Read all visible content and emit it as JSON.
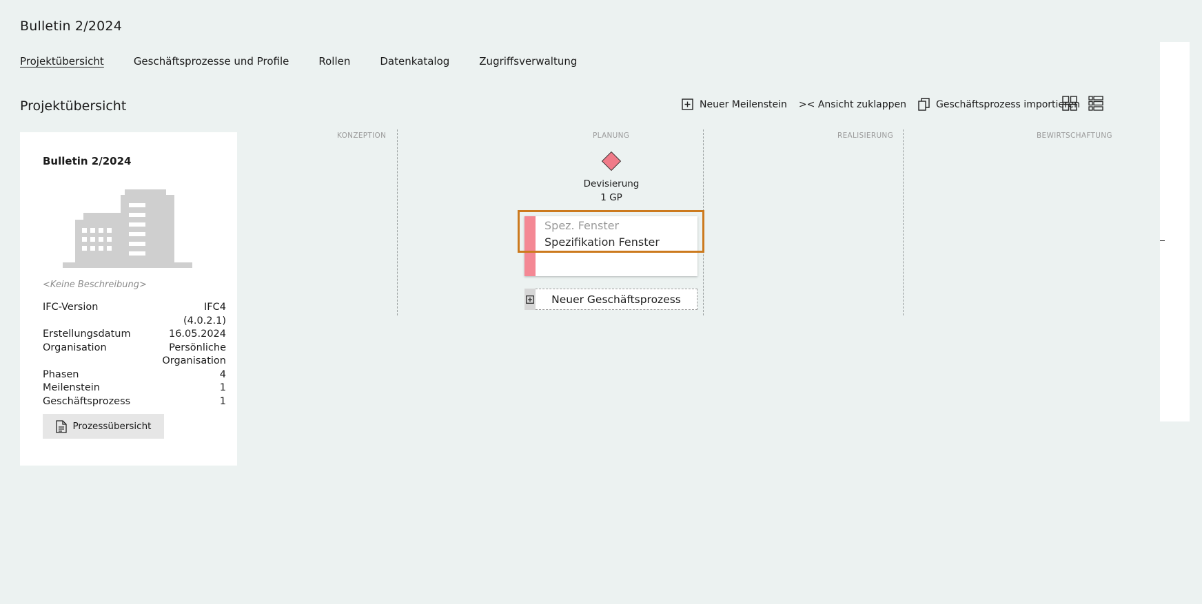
{
  "app": {
    "title": "Bulletin 2/2024"
  },
  "tabs": [
    {
      "label": "Projektübersicht",
      "active": true
    },
    {
      "label": "Geschäftsprozesse und Profile"
    },
    {
      "label": "Rollen"
    },
    {
      "label": "Datenkatalog"
    },
    {
      "label": "Zugriffsverwaltung"
    }
  ],
  "page": {
    "title": "Projektübersicht"
  },
  "toolbar": {
    "new_milestone": "Neuer Meilenstein",
    "collapse_view": "&gt;&lt; Ansicht zuklappen",
    "import_process": "Geschäftsprozess importieren",
    "grid_view_icon": "grid-view-icon",
    "list_view_icon": "list-view-icon"
  },
  "project_card": {
    "title": "Bulletin 2/2024",
    "image_icon": "building-icon",
    "description": "<Keine Beschreibung>",
    "properties": [
      {
        "label": "IFC-Version",
        "value": "IFC4\n(4.0.2.1)"
      },
      {
        "label": "Erstellungsdatum",
        "value": "16.05.2024"
      },
      {
        "label": "Organisation",
        "value": "Persönliche\nOrganisation"
      },
      {
        "label": "Phasen",
        "value": "4"
      },
      {
        "label": "Meilenstein",
        "value": "1"
      },
      {
        "label": "Geschäftsprozess",
        "value": "1"
      }
    ],
    "overview_button": "Prozessübersicht"
  },
  "phases": [
    "KONZEPTION",
    "PLANUNG",
    "REALISIERUNG",
    "BEWIRTSCHAFTUNG"
  ],
  "milestone": {
    "name": "Devisierung",
    "count": "1 GP",
    "color": "#f07a88"
  },
  "process": {
    "short_name": "Spez. Fenster",
    "name": "Spezifikation Fenster",
    "color": "#f48894"
  },
  "new_process_label": "Neuer Geschäftsprozess",
  "highlight_color": "#cc7a1e"
}
